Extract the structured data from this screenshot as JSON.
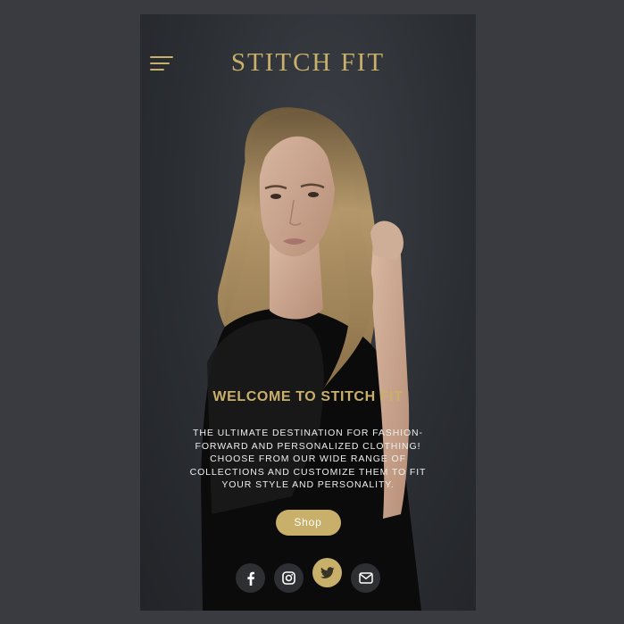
{
  "app": {
    "brand": "STITCH FIT"
  },
  "hero": {
    "welcome_title": "WELCOME TO STITCH FIT",
    "description": "The ultimate destination for fashion-forward and personalized clothing! Choose from our wide range of collections and customize them to fit your style and personality.",
    "shop_label": "Shop"
  },
  "socials": [
    {
      "icon": "facebook-icon",
      "active": false
    },
    {
      "icon": "instagram-icon",
      "active": false
    },
    {
      "icon": "twitter-icon",
      "active": true
    },
    {
      "icon": "mail-icon",
      "active": false
    }
  ],
  "colors": {
    "accent": "#c9b06a",
    "outer_background": "#393b41",
    "screen_background": "#2b2e33"
  }
}
